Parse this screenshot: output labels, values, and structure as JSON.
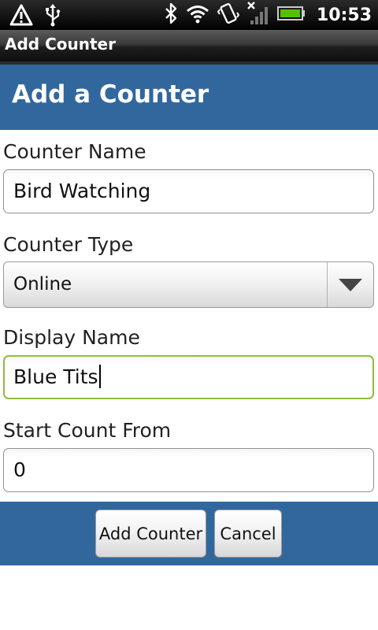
{
  "status_bar": {
    "time": "10:53",
    "icons": [
      "alert-icon",
      "usb-icon",
      "bluetooth-icon",
      "wifi-icon",
      "vibrate-icon",
      "no-signal-icon",
      "battery-icon"
    ]
  },
  "window": {
    "title": "Add Counter"
  },
  "header": {
    "heading": "Add a Counter"
  },
  "form": {
    "counter_name": {
      "label": "Counter Name",
      "value": "Bird Watching"
    },
    "counter_type": {
      "label": "Counter Type",
      "value": "Online"
    },
    "display_name": {
      "label": "Display Name",
      "value": "Blue Tits"
    },
    "start_count": {
      "label": "Start Count From",
      "value": "0"
    }
  },
  "actions": {
    "add_label": "Add Counter",
    "cancel_label": "Cancel"
  },
  "colors": {
    "accent": "#32679e",
    "focus_border": "#8ebd3e"
  }
}
